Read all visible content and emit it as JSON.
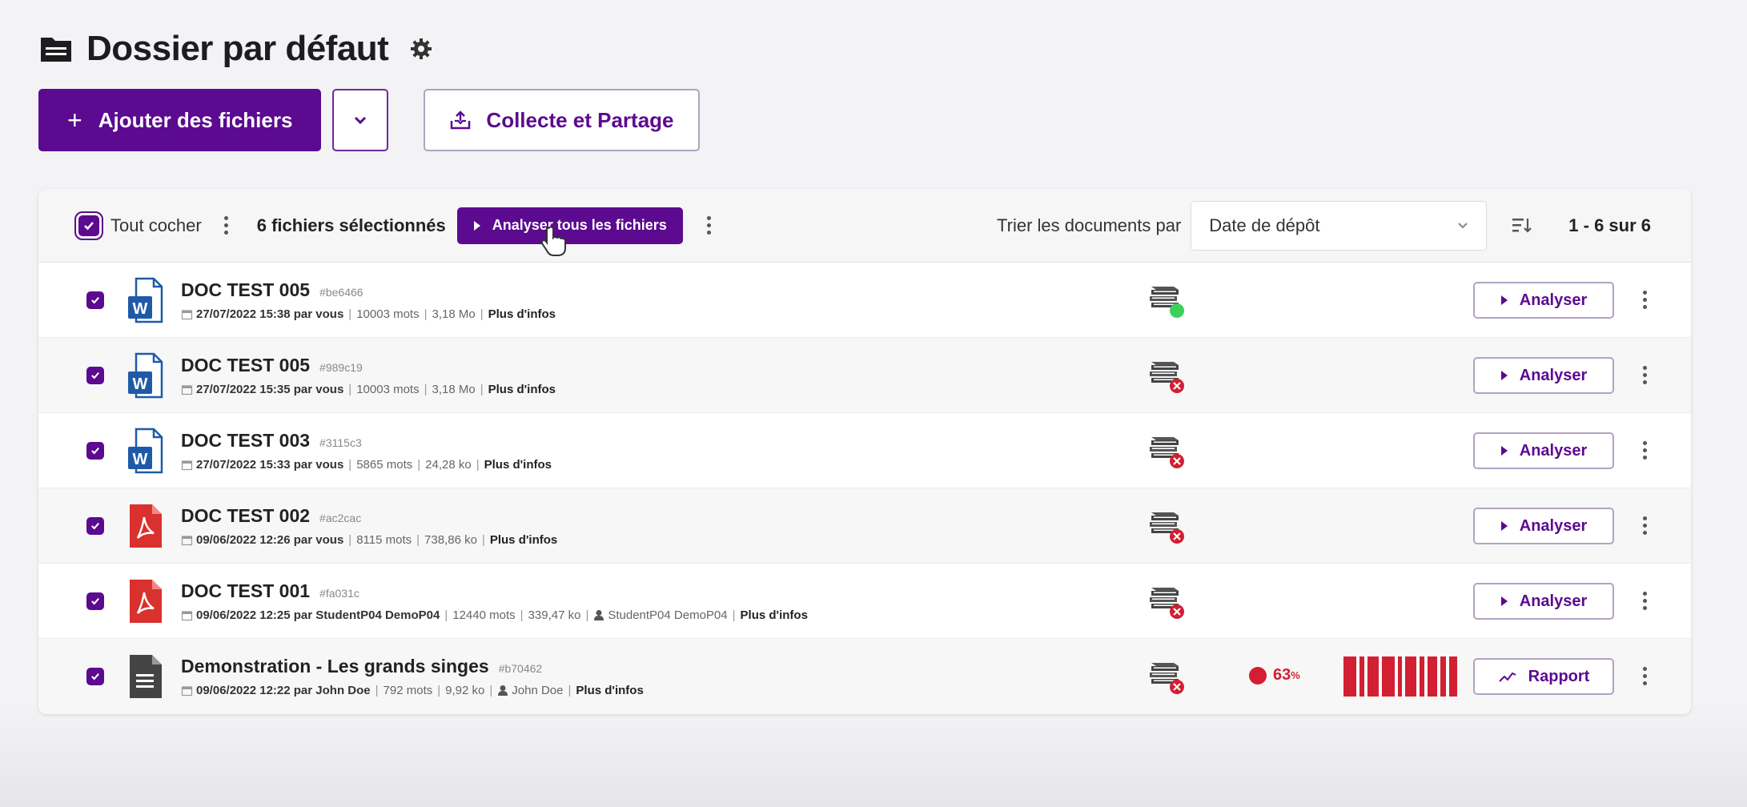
{
  "header": {
    "title": "Dossier par défaut",
    "add_files_label": "Ajouter des fichiers",
    "collect_share_label": "Collecte et Partage"
  },
  "toolbar": {
    "check_all_label": "Tout cocher",
    "selected_count_label": "6 fichiers sélectionnés",
    "analyse_all_label": "Analyser tous les fichiers",
    "sort_label": "Trier les documents par",
    "sort_value": "Date de dépôt",
    "pagination": "1 - 6 sur 6"
  },
  "files": [
    {
      "name": "DOC TEST 005",
      "hash": "#be6466",
      "type": "word",
      "date_by": "27/07/2022 15:38 par vous",
      "words": "10003 mots",
      "size": "3,18 Mo",
      "author": "",
      "more_label": "Plus d'infos",
      "db_status": "ok",
      "score": "",
      "action_label": "Analyser",
      "action_type": "analyse"
    },
    {
      "name": "DOC TEST 005",
      "hash": "#989c19",
      "type": "word",
      "date_by": "27/07/2022 15:35 par vous",
      "words": "10003 mots",
      "size": "3,18 Mo",
      "author": "",
      "more_label": "Plus d'infos",
      "db_status": "error",
      "score": "",
      "action_label": "Analyser",
      "action_type": "analyse"
    },
    {
      "name": "DOC TEST 003",
      "hash": "#3115c3",
      "type": "word",
      "date_by": "27/07/2022 15:33 par vous",
      "words": "5865 mots",
      "size": "24,28 ko",
      "author": "",
      "more_label": "Plus d'infos",
      "db_status": "error",
      "score": "",
      "action_label": "Analyser",
      "action_type": "analyse"
    },
    {
      "name": "DOC TEST 002",
      "hash": "#ac2cac",
      "type": "pdf",
      "date_by": "09/06/2022 12:26 par vous",
      "words": "8115 mots",
      "size": "738,86 ko",
      "author": "",
      "more_label": "Plus d'infos",
      "db_status": "error",
      "score": "",
      "action_label": "Analyser",
      "action_type": "analyse"
    },
    {
      "name": "DOC TEST 001",
      "hash": "#fa031c",
      "type": "pdf",
      "date_by": "09/06/2022 12:25 par StudentP04 DemoP04",
      "words": "12440 mots",
      "size": "339,47 ko",
      "author": "StudentP04 DemoP04",
      "more_label": "Plus d'infos",
      "db_status": "error",
      "score": "",
      "action_label": "Analyser",
      "action_type": "analyse"
    },
    {
      "name": "Demonstration - Les grands singes",
      "hash": "#b70462",
      "type": "text",
      "date_by": "09/06/2022 12:22 par John Doe",
      "words": "792 mots",
      "size": "9,92 ko",
      "author": "John Doe",
      "more_label": "Plus d'infos",
      "db_status": "error",
      "score": "63",
      "score_unit": "%",
      "action_label": "Rapport",
      "action_type": "report"
    }
  ],
  "colors": {
    "primary": "#5c0a8f",
    "danger": "#d21f32",
    "success": "#3ccf5a",
    "word": "#1f5aa8",
    "pdf": "#d9312d",
    "text": "#444444"
  }
}
